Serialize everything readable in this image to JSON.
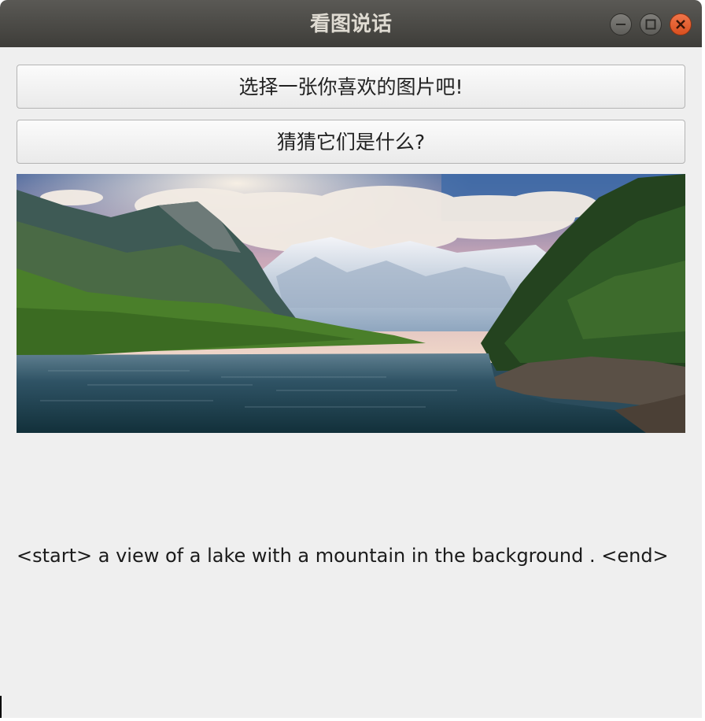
{
  "window": {
    "title": "看图说话",
    "controls": [
      "minimize-icon",
      "maximize-icon",
      "close-icon"
    ],
    "close_color": "#e95420"
  },
  "buttons": {
    "choose_image": "选择一张你喜欢的图片吧!",
    "guess": "猜猜它们是什么?"
  },
  "image": {
    "subject": "mountain lake landscape"
  },
  "caption": "<start> a view of a lake with a mountain in the background . <end>"
}
